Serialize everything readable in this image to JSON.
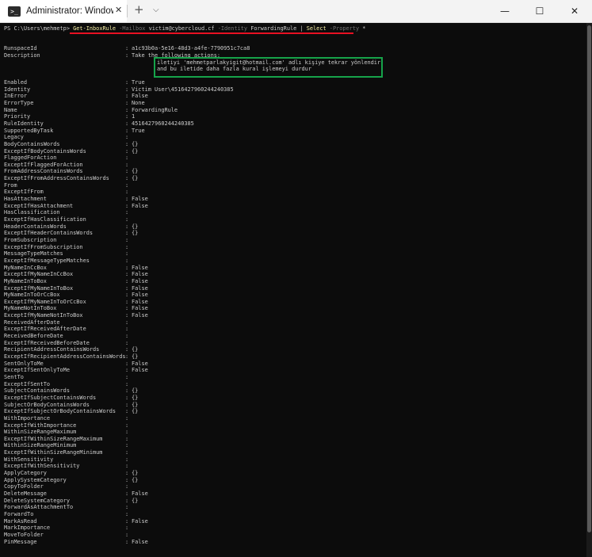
{
  "window": {
    "tab_title": "Administrator: Windows PowerS",
    "tab_icon_text": ">_",
    "close_tab_glyph": "✕",
    "new_tab_glyph": "+",
    "dropdown_glyph": "⌵",
    "minimize_glyph": "—",
    "maximize_glyph": "☐",
    "close_glyph": "✕"
  },
  "prompt": {
    "path": "PS C:\\Users\\mehmetp> ",
    "cmdlet": "Get-InboxRule",
    "p1": " -Mailbox ",
    "a1": "victim@cybercloud.cf",
    "p2": " -Identity ",
    "a2": "ForwardingRule",
    "pipe": " | ",
    "cmd2": "Select",
    "p3": " -Property ",
    "a3": "*"
  },
  "highlight": {
    "line1": "iletiyi 'mehmetparlakyigit@hotmail.com' adlı kişiye tekrar yönlendir",
    "line2": "and bu iletide daha fazla kural işlemeyi durdur"
  },
  "rows_top": [
    {
      "k": "RunspaceId",
      "v": "a1c93b0a-5e16-48d3-a4fe-7790951c7ca8"
    },
    {
      "k": "Description",
      "v": "Take the following actions:"
    }
  ],
  "rows": [
    {
      "k": "Enabled",
      "v": "True"
    },
    {
      "k": "Identity",
      "v": "Victim User\\4516427960244240385"
    },
    {
      "k": "InError",
      "v": "False"
    },
    {
      "k": "ErrorType",
      "v": "None"
    },
    {
      "k": "Name",
      "v": "ForwardingRule"
    },
    {
      "k": "Priority",
      "v": "1"
    },
    {
      "k": "RuleIdentity",
      "v": "4516427960244240385"
    },
    {
      "k": "SupportedByTask",
      "v": "True"
    },
    {
      "k": "Legacy",
      "v": ""
    },
    {
      "k": "BodyContainsWords",
      "v": "{}"
    },
    {
      "k": "ExceptIfBodyContainsWords",
      "v": "{}"
    },
    {
      "k": "FlaggedForAction",
      "v": ""
    },
    {
      "k": "ExceptIfFlaggedForAction",
      "v": ""
    },
    {
      "k": "FromAddressContainsWords",
      "v": "{}"
    },
    {
      "k": "ExceptIfFromAddressContainsWords",
      "v": "{}"
    },
    {
      "k": "From",
      "v": ""
    },
    {
      "k": "ExceptIfFrom",
      "v": ""
    },
    {
      "k": "HasAttachment",
      "v": "False"
    },
    {
      "k": "ExceptIfHasAttachment",
      "v": "False"
    },
    {
      "k": "HasClassification",
      "v": ""
    },
    {
      "k": "ExceptIfHasClassification",
      "v": ""
    },
    {
      "k": "HeaderContainsWords",
      "v": "{}"
    },
    {
      "k": "ExceptIfHeaderContainsWords",
      "v": "{}"
    },
    {
      "k": "FromSubscription",
      "v": ""
    },
    {
      "k": "ExceptIfFromSubscription",
      "v": ""
    },
    {
      "k": "MessageTypeMatches",
      "v": ""
    },
    {
      "k": "ExceptIfMessageTypeMatches",
      "v": ""
    },
    {
      "k": "MyNameInCcBox",
      "v": "False"
    },
    {
      "k": "ExceptIfMyNameInCcBox",
      "v": "False"
    },
    {
      "k": "MyNameInToBox",
      "v": "False"
    },
    {
      "k": "ExceptIfMyNameInToBox",
      "v": "False"
    },
    {
      "k": "MyNameInToOrCcBox",
      "v": "False"
    },
    {
      "k": "ExceptIfMyNameInToOrCcBox",
      "v": "False"
    },
    {
      "k": "MyNameNotInToBox",
      "v": "False"
    },
    {
      "k": "ExceptIfMyNameNotInToBox",
      "v": "False"
    },
    {
      "k": "ReceivedAfterDate",
      "v": ""
    },
    {
      "k": "ExceptIfReceivedAfterDate",
      "v": ""
    },
    {
      "k": "ReceivedBeforeDate",
      "v": ""
    },
    {
      "k": "ExceptIfReceivedBeforeDate",
      "v": ""
    },
    {
      "k": "RecipientAddressContainsWords",
      "v": "{}"
    },
    {
      "k": "ExceptIfRecipientAddressContainsWords",
      "v": "{}"
    },
    {
      "k": "SentOnlyToMe",
      "v": "False"
    },
    {
      "k": "ExceptIfSentOnlyToMe",
      "v": "False"
    },
    {
      "k": "SentTo",
      "v": ""
    },
    {
      "k": "ExceptIfSentTo",
      "v": ""
    },
    {
      "k": "SubjectContainsWords",
      "v": "{}"
    },
    {
      "k": "ExceptIfSubjectContainsWords",
      "v": "{}"
    },
    {
      "k": "SubjectOrBodyContainsWords",
      "v": "{}"
    },
    {
      "k": "ExceptIfSubjectOrBodyContainsWords",
      "v": "{}"
    },
    {
      "k": "WithImportance",
      "v": ""
    },
    {
      "k": "ExceptIfWithImportance",
      "v": ""
    },
    {
      "k": "WithinSizeRangeMaximum",
      "v": ""
    },
    {
      "k": "ExceptIfWithinSizeRangeMaximum",
      "v": ""
    },
    {
      "k": "WithinSizeRangeMinimum",
      "v": ""
    },
    {
      "k": "ExceptIfWithinSizeRangeMinimum",
      "v": ""
    },
    {
      "k": "WithSensitivity",
      "v": ""
    },
    {
      "k": "ExceptIfWithSensitivity",
      "v": ""
    },
    {
      "k": "ApplyCategory",
      "v": "{}"
    },
    {
      "k": "ApplySystemCategory",
      "v": "{}"
    },
    {
      "k": "CopyToFolder",
      "v": ""
    },
    {
      "k": "DeleteMessage",
      "v": "False"
    },
    {
      "k": "DeleteSystemCategory",
      "v": "{}"
    },
    {
      "k": "ForwardAsAttachmentTo",
      "v": ""
    },
    {
      "k": "ForwardTo",
      "v": ""
    },
    {
      "k": "MarkAsRead",
      "v": "False"
    },
    {
      "k": "MarkImportance",
      "v": ""
    },
    {
      "k": "MoveToFolder",
      "v": ""
    },
    {
      "k": "PinMessage",
      "v": "False"
    }
  ]
}
